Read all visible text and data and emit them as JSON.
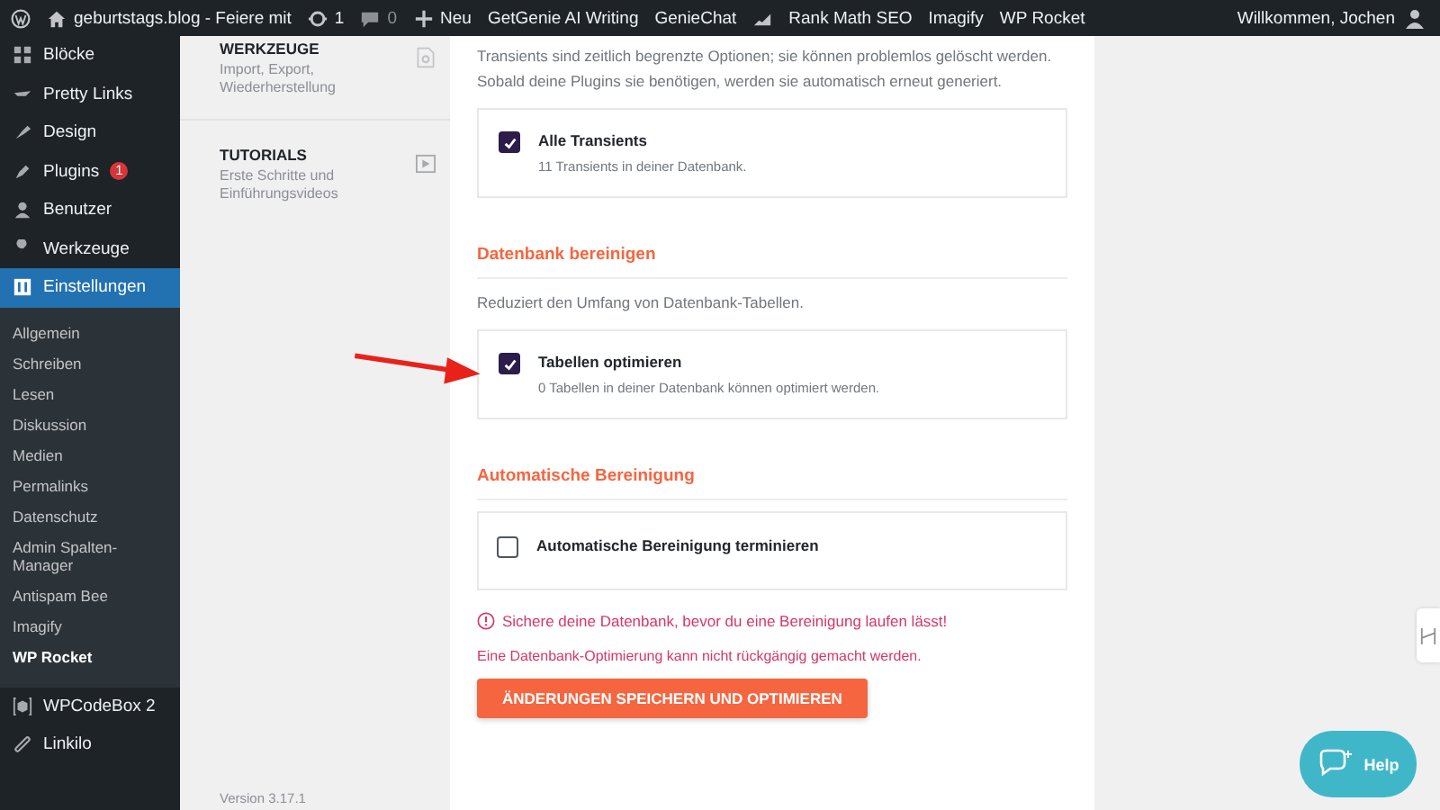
{
  "admin_bar": {
    "site_title": "geburtstags.blog - Feiere mit",
    "updates": "1",
    "comments": "0",
    "new_label": "Neu",
    "items": [
      "GetGenie AI Writing",
      "GenieChat",
      "Rank Math SEO",
      "Imagify",
      "WP Rocket"
    ],
    "greeting": "Willkommen, Jochen"
  },
  "sidebar": {
    "top": [
      {
        "label": "Blöcke",
        "selected": false
      },
      {
        "label": "Pretty Links",
        "selected": false
      },
      {
        "label": "Design",
        "selected": false
      },
      {
        "label": "Plugins",
        "badge": "1",
        "selected": false
      },
      {
        "label": "Benutzer",
        "selected": false
      },
      {
        "label": "Werkzeuge",
        "selected": false
      },
      {
        "label": "Einstellungen",
        "selected": true
      }
    ],
    "submenu": [
      {
        "label": "Allgemein",
        "selected": false
      },
      {
        "label": "Schreiben",
        "selected": false
      },
      {
        "label": "Lesen",
        "selected": false
      },
      {
        "label": "Diskussion",
        "selected": false
      },
      {
        "label": "Medien",
        "selected": false
      },
      {
        "label": "Permalinks",
        "selected": false
      },
      {
        "label": "Datenschutz",
        "selected": false
      },
      {
        "label": "Admin Spalten-Manager",
        "selected": false
      },
      {
        "label": "Antispam Bee",
        "selected": false
      },
      {
        "label": "Imagify",
        "selected": false
      },
      {
        "label": "WP Rocket",
        "selected": true
      }
    ],
    "bottom": [
      {
        "label": "WPCodeBox 2",
        "selected": false
      },
      {
        "label": "Linkilo",
        "selected": false
      }
    ]
  },
  "panel": {
    "sections": [
      {
        "title": "WERKZEUGE",
        "description": "Import, Export, Wiederherstellung"
      },
      {
        "title": "TUTORIALS",
        "description": "Erste Schritte und Einführungsvideos"
      }
    ],
    "version": "Version 3.17.1"
  },
  "content": {
    "intro": "Transients sind zeitlich begrenzte Optionen; sie können problemlos gelöscht werden. Sobald deine Plugins sie benötigen, werden sie automatisch erneut generiert.",
    "transients": {
      "label": "Alle Transients",
      "description": "11 Transients in deiner Datenbank.",
      "checked": true
    },
    "sections": [
      {
        "title": "Datenbank bereinigen",
        "description": "Reduziert den Umfang von Datenbank-Tabellen.",
        "option": {
          "label": "Tabellen optimieren",
          "description": "0 Tabellen in deiner Datenbank können optimiert werden.",
          "checked": true
        }
      },
      {
        "title": "Automatische Bereinigung",
        "option": {
          "label": "Automatische Bereinigung terminieren",
          "checked": false
        }
      }
    ],
    "warning": "Sichere deine Datenbank, bevor du eine Bereinigung laufen lässt!",
    "notice": "Eine Datenbank-Optimierung kann nicht rückgängig gemacht werden.",
    "button": "ÄNDERUNGEN SPEICHERN UND OPTIMIEREN"
  },
  "help_label": "Help"
}
